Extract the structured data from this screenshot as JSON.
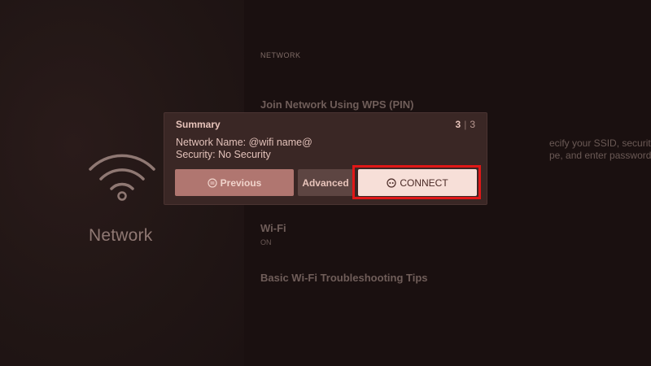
{
  "left_panel": {
    "title": "Network",
    "icon": "wifi-icon"
  },
  "settings": {
    "section_header": "NETWORK",
    "items": [
      {
        "title": "Join Network Using WPS (PIN)"
      },
      {
        "title": "Wi-Fi",
        "sub": "ON"
      },
      {
        "title": "Basic Wi-Fi Troubleshooting Tips"
      }
    ],
    "description_line1": "ecify your SSID, security",
    "description_line2": "pe, and enter password."
  },
  "dialog": {
    "title": "Summary",
    "step_current": "3",
    "step_separator": "|",
    "step_total": "3",
    "network_name": "Network Name: @wifi name@",
    "security": "Security: No Security",
    "buttons": {
      "previous": "Previous",
      "advanced": "Advanced",
      "connect": "CONNECT"
    }
  },
  "colors": {
    "focus_ring": "#e01717",
    "dialog_bg": "#3a2725"
  }
}
